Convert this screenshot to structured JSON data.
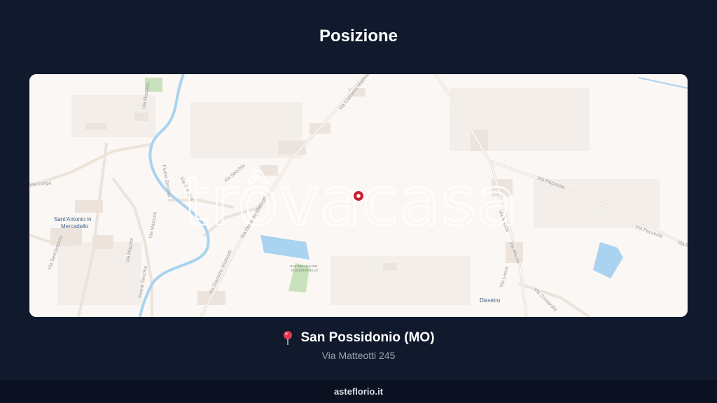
{
  "header": {
    "title": "Posizione"
  },
  "map": {
    "watermark": "trôvacasa",
    "places": {
      "sant_antonio_line1": "Sant'Antonio in",
      "sant_antonio_line2": "Mercadello",
      "disvetro": "Disvetro"
    },
    "poi": {
      "line1": "OASI DELLE CAVE",
      "line2": "DI BUDRIGHELLO"
    },
    "streets": {
      "giacomo_matteotti_top": "Via Giacomo Matteotti",
      "giacomo_matteotti_mid": "Via Giacomo Matteotti",
      "giacomo_matteotti_low": "Via Giacomo Matteotti",
      "secchia": "Via Secchia",
      "secchia2": "Via Secchia",
      "mazzoni": "Via Mazzoni",
      "mazzoni2": "Via Mazzoni",
      "mazzini": "Via Mazzini",
      "lunga": "Via Lunga",
      "sant_antonio": "Via Sant'Antonio",
      "mazza": "Via Mazza",
      "mazza2": "Via Mazza",
      "pezzente": "Via Pezzente",
      "pezzente2": "Via Pezzente",
      "pezzente3": "Via Pe",
      "canalvecchio": "Via Canalvecchio",
      "lecca": "Via Lecca",
      "concordia": "Via Concordia",
      "fiume": "Fiume Secchia",
      "fiume2": "Fiume Secchia"
    },
    "colors": {
      "river": "#a9d3ee",
      "water": "#a9d3ee",
      "green": "#c9e2bb",
      "pin": "#c8202f"
    }
  },
  "location": {
    "pin_icon": "map-pin-icon",
    "city": "San Possidonio (MO)",
    "address": "Via Matteotti 245"
  },
  "footer": {
    "site": "asteflorio.it"
  }
}
